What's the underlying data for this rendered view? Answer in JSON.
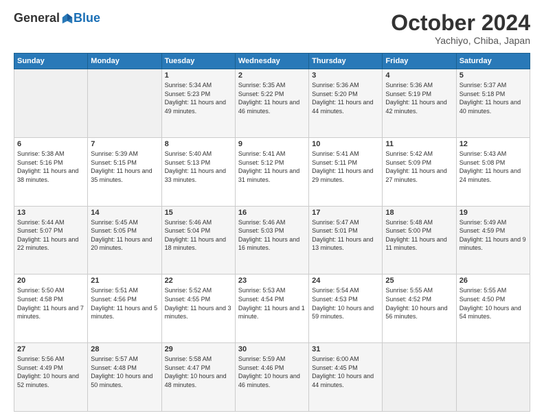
{
  "header": {
    "logo_general": "General",
    "logo_blue": "Blue",
    "month": "October 2024",
    "location": "Yachiyo, Chiba, Japan"
  },
  "weekdays": [
    "Sunday",
    "Monday",
    "Tuesday",
    "Wednesday",
    "Thursday",
    "Friday",
    "Saturday"
  ],
  "weeks": [
    [
      {
        "day": "",
        "info": ""
      },
      {
        "day": "",
        "info": ""
      },
      {
        "day": "1",
        "info": "Sunrise: 5:34 AM\nSunset: 5:23 PM\nDaylight: 11 hours and 49 minutes."
      },
      {
        "day": "2",
        "info": "Sunrise: 5:35 AM\nSunset: 5:22 PM\nDaylight: 11 hours and 46 minutes."
      },
      {
        "day": "3",
        "info": "Sunrise: 5:36 AM\nSunset: 5:20 PM\nDaylight: 11 hours and 44 minutes."
      },
      {
        "day": "4",
        "info": "Sunrise: 5:36 AM\nSunset: 5:19 PM\nDaylight: 11 hours and 42 minutes."
      },
      {
        "day": "5",
        "info": "Sunrise: 5:37 AM\nSunset: 5:18 PM\nDaylight: 11 hours and 40 minutes."
      }
    ],
    [
      {
        "day": "6",
        "info": "Sunrise: 5:38 AM\nSunset: 5:16 PM\nDaylight: 11 hours and 38 minutes."
      },
      {
        "day": "7",
        "info": "Sunrise: 5:39 AM\nSunset: 5:15 PM\nDaylight: 11 hours and 35 minutes."
      },
      {
        "day": "8",
        "info": "Sunrise: 5:40 AM\nSunset: 5:13 PM\nDaylight: 11 hours and 33 minutes."
      },
      {
        "day": "9",
        "info": "Sunrise: 5:41 AM\nSunset: 5:12 PM\nDaylight: 11 hours and 31 minutes."
      },
      {
        "day": "10",
        "info": "Sunrise: 5:41 AM\nSunset: 5:11 PM\nDaylight: 11 hours and 29 minutes."
      },
      {
        "day": "11",
        "info": "Sunrise: 5:42 AM\nSunset: 5:09 PM\nDaylight: 11 hours and 27 minutes."
      },
      {
        "day": "12",
        "info": "Sunrise: 5:43 AM\nSunset: 5:08 PM\nDaylight: 11 hours and 24 minutes."
      }
    ],
    [
      {
        "day": "13",
        "info": "Sunrise: 5:44 AM\nSunset: 5:07 PM\nDaylight: 11 hours and 22 minutes."
      },
      {
        "day": "14",
        "info": "Sunrise: 5:45 AM\nSunset: 5:05 PM\nDaylight: 11 hours and 20 minutes."
      },
      {
        "day": "15",
        "info": "Sunrise: 5:46 AM\nSunset: 5:04 PM\nDaylight: 11 hours and 18 minutes."
      },
      {
        "day": "16",
        "info": "Sunrise: 5:46 AM\nSunset: 5:03 PM\nDaylight: 11 hours and 16 minutes."
      },
      {
        "day": "17",
        "info": "Sunrise: 5:47 AM\nSunset: 5:01 PM\nDaylight: 11 hours and 13 minutes."
      },
      {
        "day": "18",
        "info": "Sunrise: 5:48 AM\nSunset: 5:00 PM\nDaylight: 11 hours and 11 minutes."
      },
      {
        "day": "19",
        "info": "Sunrise: 5:49 AM\nSunset: 4:59 PM\nDaylight: 11 hours and 9 minutes."
      }
    ],
    [
      {
        "day": "20",
        "info": "Sunrise: 5:50 AM\nSunset: 4:58 PM\nDaylight: 11 hours and 7 minutes."
      },
      {
        "day": "21",
        "info": "Sunrise: 5:51 AM\nSunset: 4:56 PM\nDaylight: 11 hours and 5 minutes."
      },
      {
        "day": "22",
        "info": "Sunrise: 5:52 AM\nSunset: 4:55 PM\nDaylight: 11 hours and 3 minutes."
      },
      {
        "day": "23",
        "info": "Sunrise: 5:53 AM\nSunset: 4:54 PM\nDaylight: 11 hours and 1 minute."
      },
      {
        "day": "24",
        "info": "Sunrise: 5:54 AM\nSunset: 4:53 PM\nDaylight: 10 hours and 59 minutes."
      },
      {
        "day": "25",
        "info": "Sunrise: 5:55 AM\nSunset: 4:52 PM\nDaylight: 10 hours and 56 minutes."
      },
      {
        "day": "26",
        "info": "Sunrise: 5:55 AM\nSunset: 4:50 PM\nDaylight: 10 hours and 54 minutes."
      }
    ],
    [
      {
        "day": "27",
        "info": "Sunrise: 5:56 AM\nSunset: 4:49 PM\nDaylight: 10 hours and 52 minutes."
      },
      {
        "day": "28",
        "info": "Sunrise: 5:57 AM\nSunset: 4:48 PM\nDaylight: 10 hours and 50 minutes."
      },
      {
        "day": "29",
        "info": "Sunrise: 5:58 AM\nSunset: 4:47 PM\nDaylight: 10 hours and 48 minutes."
      },
      {
        "day": "30",
        "info": "Sunrise: 5:59 AM\nSunset: 4:46 PM\nDaylight: 10 hours and 46 minutes."
      },
      {
        "day": "31",
        "info": "Sunrise: 6:00 AM\nSunset: 4:45 PM\nDaylight: 10 hours and 44 minutes."
      },
      {
        "day": "",
        "info": ""
      },
      {
        "day": "",
        "info": ""
      }
    ]
  ]
}
